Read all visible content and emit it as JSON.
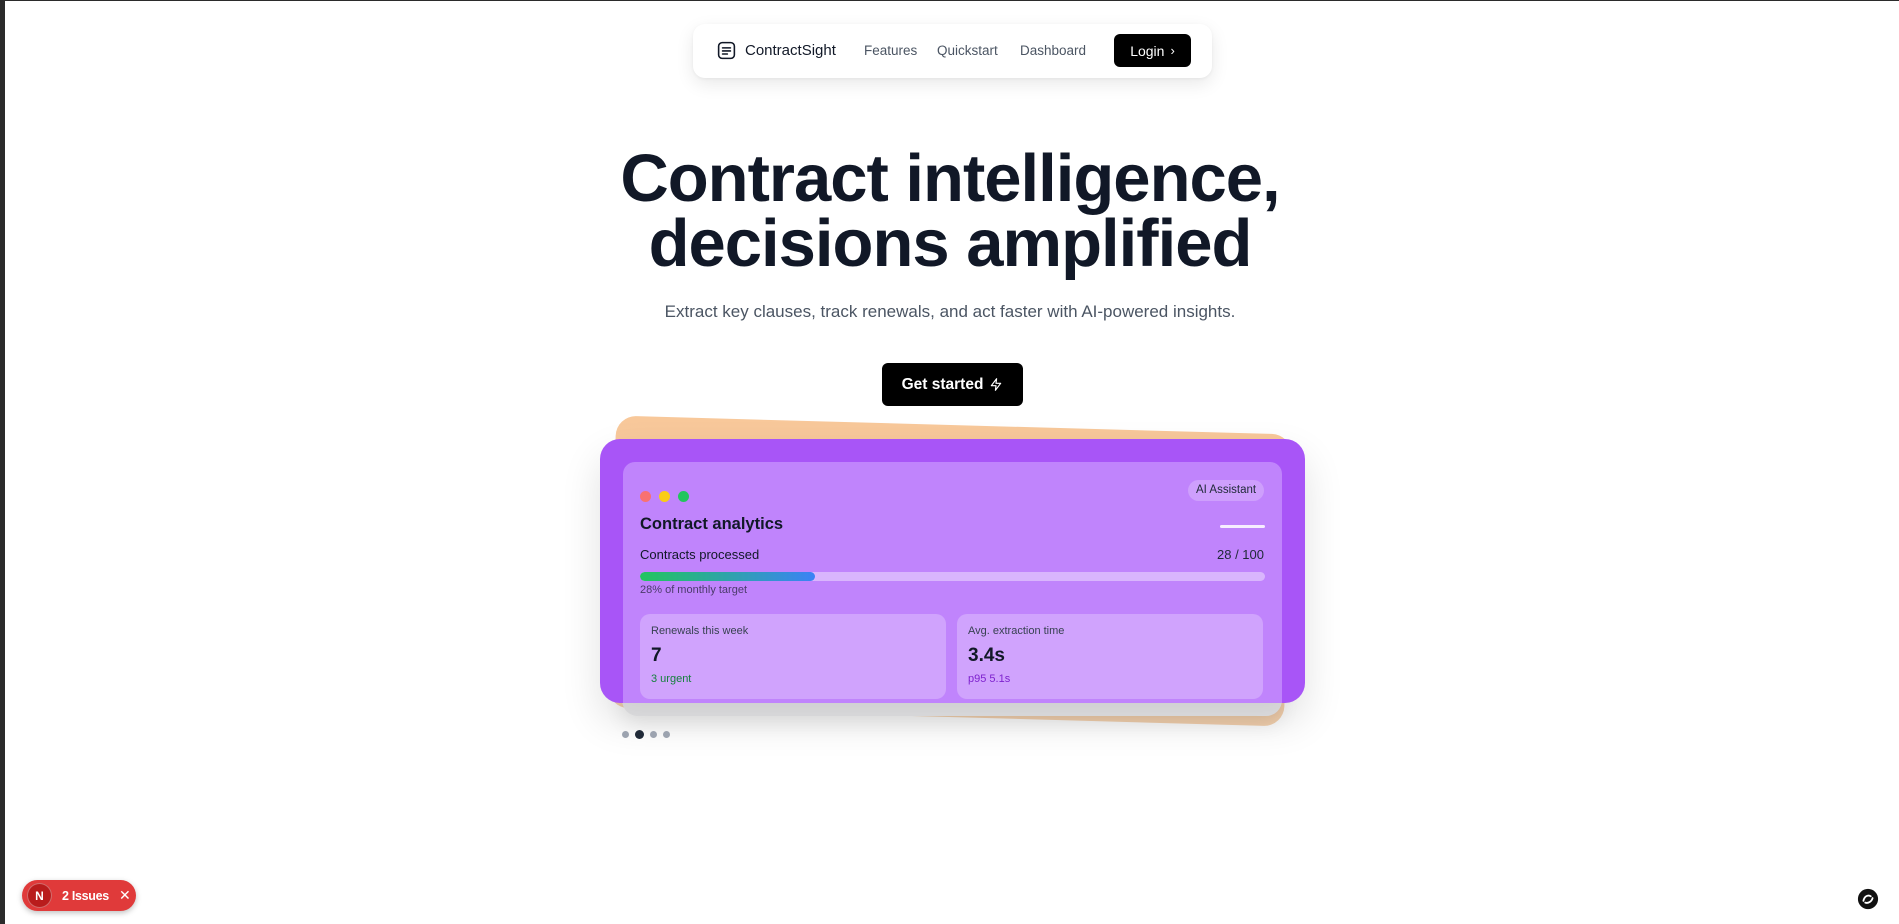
{
  "nav": {
    "brand": "ContractSight",
    "brand_icon": "document-icon",
    "links": [
      {
        "label": "Features"
      },
      {
        "label": "Quickstart"
      },
      {
        "label": "Dashboard"
      }
    ],
    "login_label": "Login",
    "login_icon": "chevron-right-icon"
  },
  "hero": {
    "title_line1": "Contract intelligence,",
    "title_line2": "decisions amplified",
    "subtitle": "Extract key clauses, track renewals, and act faster with AI-powered insights.",
    "cta_label": "Get started",
    "cta_icon": "lightning-icon"
  },
  "card": {
    "badge": "AI Assistant",
    "title": "Contract analytics",
    "metric_label": "Contracts processed",
    "metric_count": "28 / 100",
    "progress_fraction": 0.28,
    "progress_caption": "28% of monthly target",
    "stats": [
      {
        "label": "Renewals this week",
        "value": "7",
        "note": "3 urgent",
        "note_color": "#15803d"
      },
      {
        "label": "Avg. extraction time",
        "value": "3.4s",
        "note": "p95 5.1s",
        "note_color": "#7e22ce"
      }
    ],
    "window_dot_colors": [
      "#f87171",
      "#facc15",
      "#22c55e"
    ]
  },
  "pager": {
    "count": 4,
    "active_index": 1
  },
  "issues": {
    "badge_letter": "N",
    "label": "2 Issues"
  },
  "colors": {
    "accent": "#a855f7",
    "panel": "#c084fc",
    "back_card": "#f8c89a",
    "issues_red": "#e03a3a"
  }
}
